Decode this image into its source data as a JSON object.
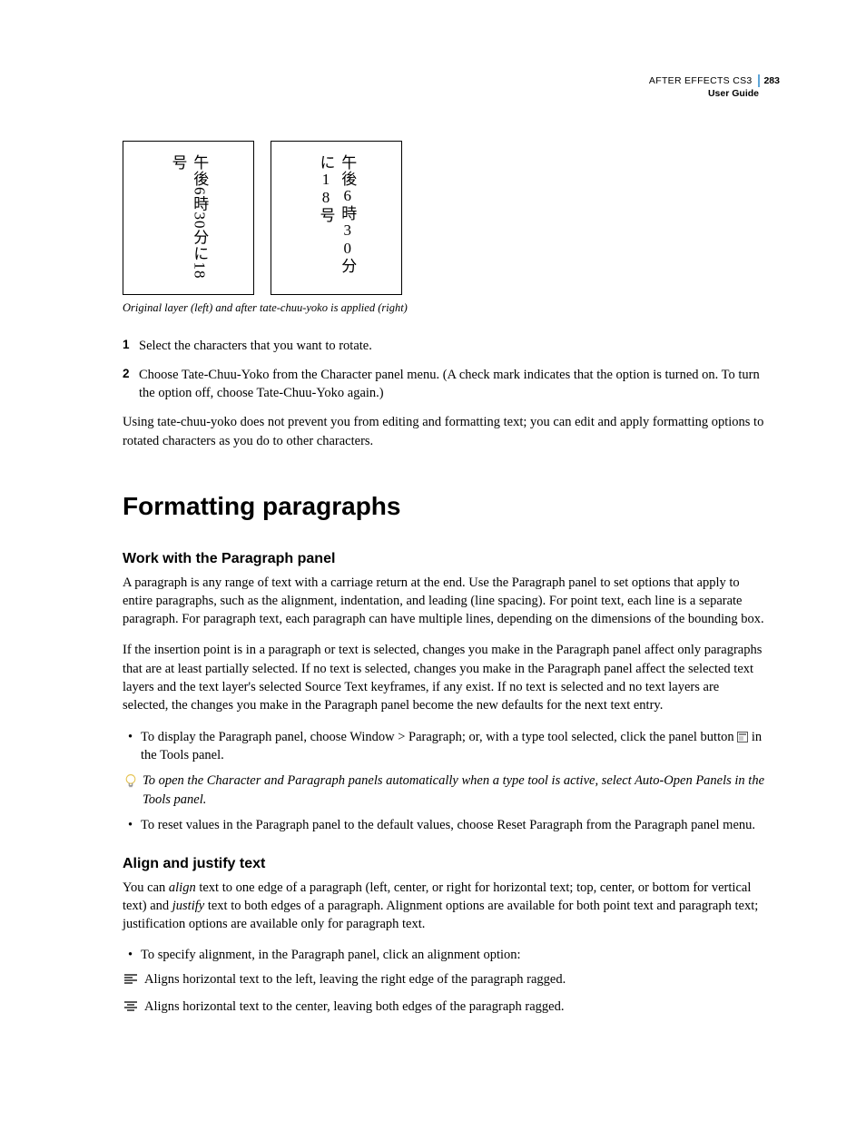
{
  "header": {
    "product": "AFTER EFFECTS CS3",
    "page_number": "283",
    "guide": "User Guide"
  },
  "figure": {
    "left_text": "午後6時30分に18号",
    "right_text": "午後6時30分に18号",
    "caption": "Original layer (left) and after tate-chuu-yoko is applied (right)"
  },
  "steps": {
    "s1_num": "1",
    "s1_text": "Select the characters that you want to rotate.",
    "s2_num": "2",
    "s2_text": "Choose Tate-Chuu-Yoko from the Character panel menu. (A check mark indicates that the option is turned on. To turn the option off, choose Tate-Chuu-Yoko again.)"
  },
  "para_after_steps": "Using tate-chuu-yoko does not prevent you from editing and formatting text; you can edit and apply formatting options to rotated characters as you do to other characters.",
  "section_title": "Formatting paragraphs",
  "sub1": {
    "title": "Work with the Paragraph panel",
    "p1": "A paragraph is any range of text with a carriage return at the end. Use the Paragraph panel to set options that apply to entire paragraphs, such as the alignment, indentation, and leading (line spacing). For point text, each line is a separate paragraph. For paragraph text, each paragraph can have multiple lines, depending on the dimensions of the bounding box.",
    "p2": "If the insertion point is in a paragraph or text is selected, changes you make in the Paragraph panel affect only paragraphs that are at least partially selected. If no text is selected, changes you make in the Paragraph panel affect the selected text layers and the text layer's selected Source Text keyframes, if any exist. If no text is selected and no text layers are selected, the changes you make in the Paragraph panel become the new defaults for the next text entry.",
    "b1_a": "To display the Paragraph panel, choose Window > Paragraph; or, with a type tool selected, click the panel button ",
    "b1_b": " in the Tools panel.",
    "tip": "To open the Character and Paragraph panels automatically when a type tool is active, select Auto-Open Panels in the Tools panel.",
    "b2": "To reset values in the Paragraph panel to the default values, choose Reset Paragraph from the Paragraph panel menu."
  },
  "sub2": {
    "title": "Align and justify text",
    "p1_a": "You can ",
    "p1_align": "align",
    "p1_b": " text to one edge of a paragraph (left, center, or right for horizontal text; top, center, or bottom for vertical text) and ",
    "p1_justify": "justify",
    "p1_c": " text to both edges of a paragraph. Alignment options are available for both point text and paragraph text; justification options are available only for paragraph text.",
    "b1": "To specify alignment, in the Paragraph panel, click an alignment option:",
    "a1": "Aligns horizontal text to the left, leaving the right edge of the paragraph ragged.",
    "a2": "Aligns horizontal text to the center, leaving both edges of the paragraph ragged."
  }
}
